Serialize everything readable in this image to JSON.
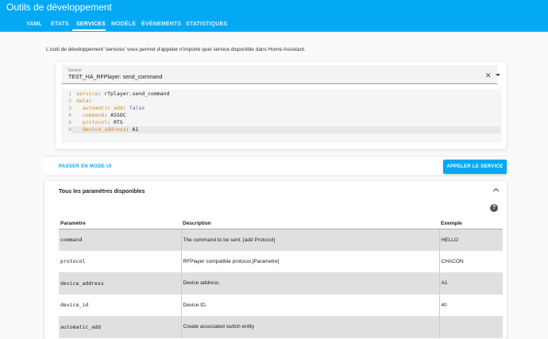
{
  "header": {
    "title": "Outils de développement"
  },
  "tabs": [
    {
      "label": "YAML"
    },
    {
      "label": "ÉTATS"
    },
    {
      "label": "SERVICES"
    },
    {
      "label": "MODÈLE"
    },
    {
      "label": "ÉVÉNEMENTS"
    },
    {
      "label": "STATISTIQUES"
    }
  ],
  "intro": {
    "text": "L'outil de développement 'services' vous permet d'appeler n'importe quel service disponible dans Home Assistant."
  },
  "service_field": {
    "label": "Service",
    "value": "TEST_HA_RFPlayer: send_command"
  },
  "code": {
    "line_numbers": [
      "1",
      "2",
      "3",
      "4",
      "5",
      "6"
    ],
    "lines": [
      {
        "key": "service",
        "sep": ": ",
        "value": "rfplayer.send_command"
      },
      {
        "key": "data",
        "sep": ":",
        "value": ""
      },
      {
        "key": "  automatic_add",
        "sep": ": ",
        "value": "false"
      },
      {
        "key": "  command",
        "sep": ": ",
        "value": "ASSOC"
      },
      {
        "key": "  protocol",
        "sep": ": ",
        "value": "RTS"
      },
      {
        "key": "  device_address",
        "sep": ": ",
        "value": "A1"
      }
    ]
  },
  "actions": {
    "ui_mode": "PASSER EN MODE UI",
    "call_service": "APPELER LE SERVICE"
  },
  "params": {
    "title": "Tous les paramètres disponibles",
    "columns": [
      "Paramètre",
      "Description",
      "Exemple"
    ],
    "rows": [
      {
        "name": "command",
        "description": "The command to be sent. [add Protocol]",
        "example": "HELLO"
      },
      {
        "name": "protocol",
        "description": "RFPlayer compatible protocol.[Parametre]",
        "example": "CHACON"
      },
      {
        "name": "device_address",
        "description": "Device address.",
        "example": "A1"
      },
      {
        "name": "device_id",
        "description": "Device ID.",
        "example": "40"
      },
      {
        "name": "automatic_add",
        "description": "Create associated switch entity",
        "example": ""
      }
    ]
  },
  "colors": {
    "accent": "#03a9f4",
    "yaml_key": "#d08c1c",
    "yaml_bool": "#5c6bc0"
  },
  "icons": {
    "clear": "close-icon",
    "dropdown": "arrow-drop-down-icon",
    "collapse": "chevron-up-icon",
    "help": "help-circle-icon"
  }
}
